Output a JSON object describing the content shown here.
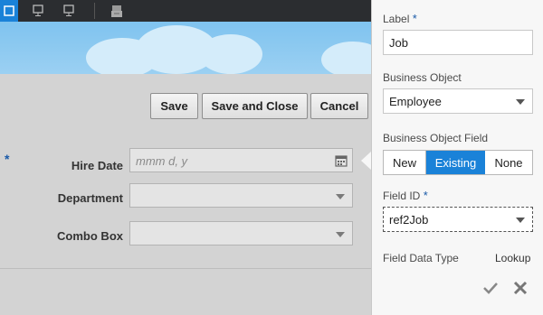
{
  "toolbar": {
    "icons": [
      "layout-icon",
      "desktop-icon",
      "monitor-icon",
      "tablet-icon"
    ],
    "active_color": "#1a82d8"
  },
  "actions": {
    "save": "Save",
    "save_close": "Save and Close",
    "cancel": "Cancel"
  },
  "form": {
    "required_mark": "*",
    "hire_date": {
      "label": "Hire Date",
      "placeholder": "mmm d, y"
    },
    "department": {
      "label": "Department",
      "value": ""
    },
    "combo_box": {
      "label": "Combo Box",
      "value": ""
    }
  },
  "panel": {
    "label_title": "Label",
    "label_value": "Job",
    "bo_title": "Business Object",
    "bo_value": "Employee",
    "bof_title": "Business Object Field",
    "bof_options": [
      "New",
      "Existing",
      "None"
    ],
    "bof_selected": "Existing",
    "field_id_title": "Field ID",
    "field_id_value": "ref2Job",
    "data_type_title": "Field Data Type",
    "data_type_value": "Lookup",
    "required_mark": "*"
  }
}
